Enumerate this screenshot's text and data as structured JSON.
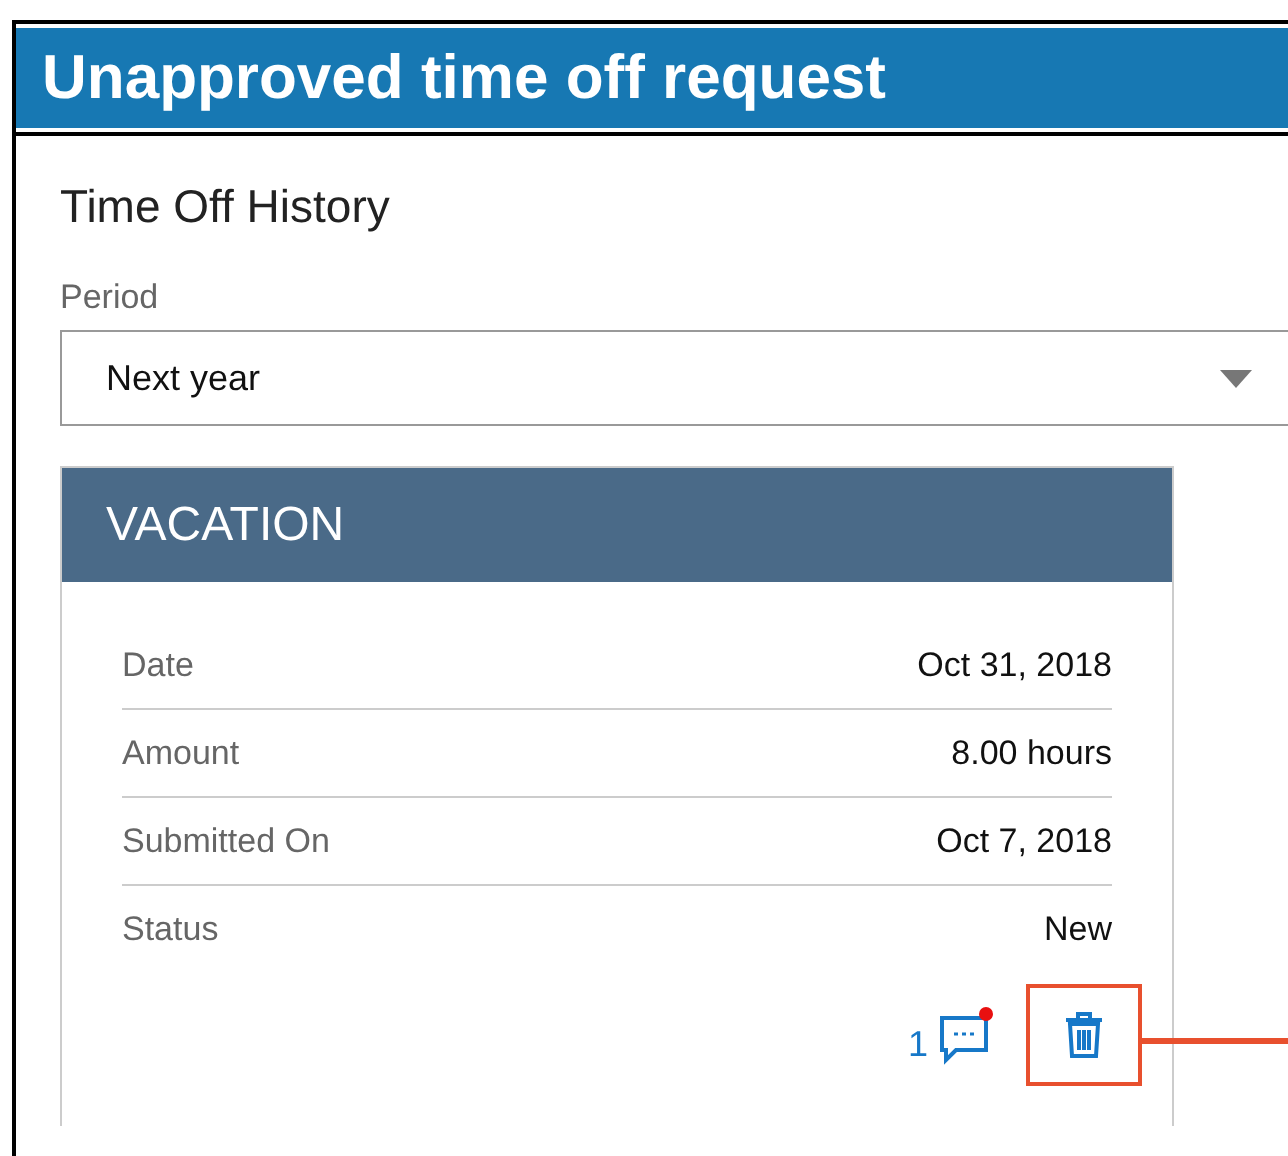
{
  "banner": {
    "title": "Unapproved time off request"
  },
  "page": {
    "title": "Time Off History"
  },
  "period": {
    "label": "Period",
    "value": "Next year"
  },
  "card": {
    "title": "VACATION",
    "rows": [
      {
        "label": "Date",
        "value": "Oct 31, 2018"
      },
      {
        "label": "Amount",
        "value": "8.00 hours"
      },
      {
        "label": "Submitted On",
        "value": "Oct 7, 2018"
      },
      {
        "label": "Status",
        "value": "New"
      }
    ],
    "comments": {
      "count": "1",
      "unread": true
    },
    "delete": {
      "highlighted": true
    }
  }
}
